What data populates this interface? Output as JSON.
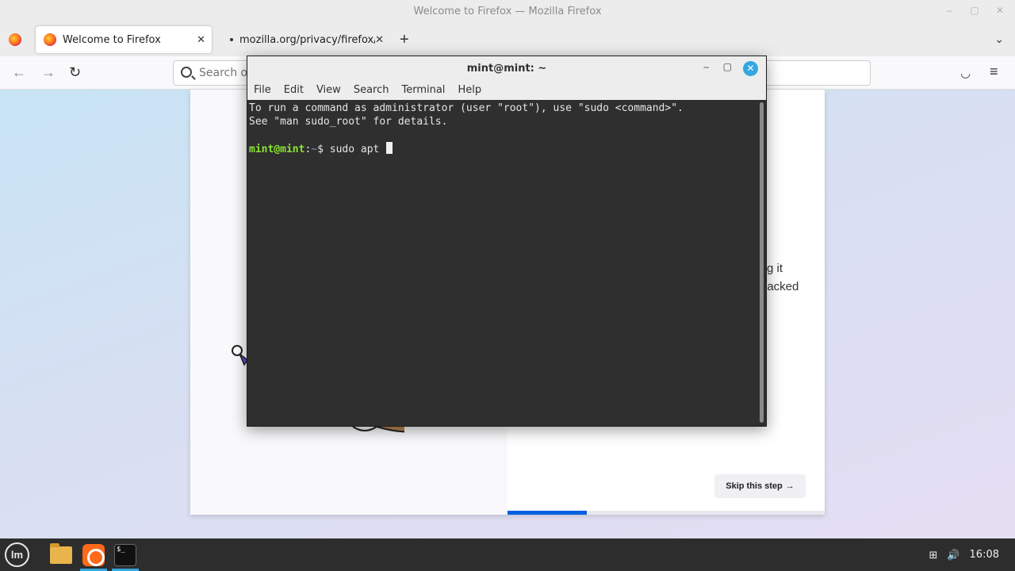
{
  "firefox": {
    "window_title": "Welcome to Firefox — Mozilla Firefox",
    "tabs": [
      {
        "label": "Welcome to Firefox",
        "close": "✕"
      },
      {
        "label": "mozilla.org/privacy/firefox/",
        "close": "✕"
      }
    ],
    "new_tab": "+",
    "tab_list": "⌄",
    "nav": {
      "back": "←",
      "forward": "→",
      "reload": "↻",
      "pocket": "◡",
      "menu": "≡"
    },
    "search": {
      "placeholder": "Search or"
    },
    "window_controls": {
      "minimize": "–",
      "maximize": "▢",
      "close": "✕"
    }
  },
  "page": {
    "partial_text_1": "g it",
    "partial_text_2": "packed",
    "skip_button": "Skip this step",
    "skip_arrow": "→",
    "progress_fraction": 0.25
  },
  "terminal": {
    "title": "mint@mint: ~",
    "menu": [
      "File",
      "Edit",
      "View",
      "Search",
      "Terminal",
      "Help"
    ],
    "lines": [
      "To run a command as administrator (user \"root\"), use \"sudo <command>\".",
      "See \"man sudo_root\" for details."
    ],
    "prompt_user": "mint@mint",
    "prompt_sep": ":",
    "prompt_path": "~",
    "prompt_symbol": "$ ",
    "command": "sudo apt ",
    "controls": {
      "minimize": "–",
      "maximize": "▢",
      "close": "✕"
    }
  },
  "taskbar": {
    "menu_icon": "lm",
    "clock": "16:08",
    "network_icon": "⊞",
    "volume_icon": "🔊"
  },
  "colors": {
    "accent": "#35a7e0",
    "prompt_user": "#8ae234",
    "prompt_path": "#729fcf",
    "progress": "#0060df"
  }
}
